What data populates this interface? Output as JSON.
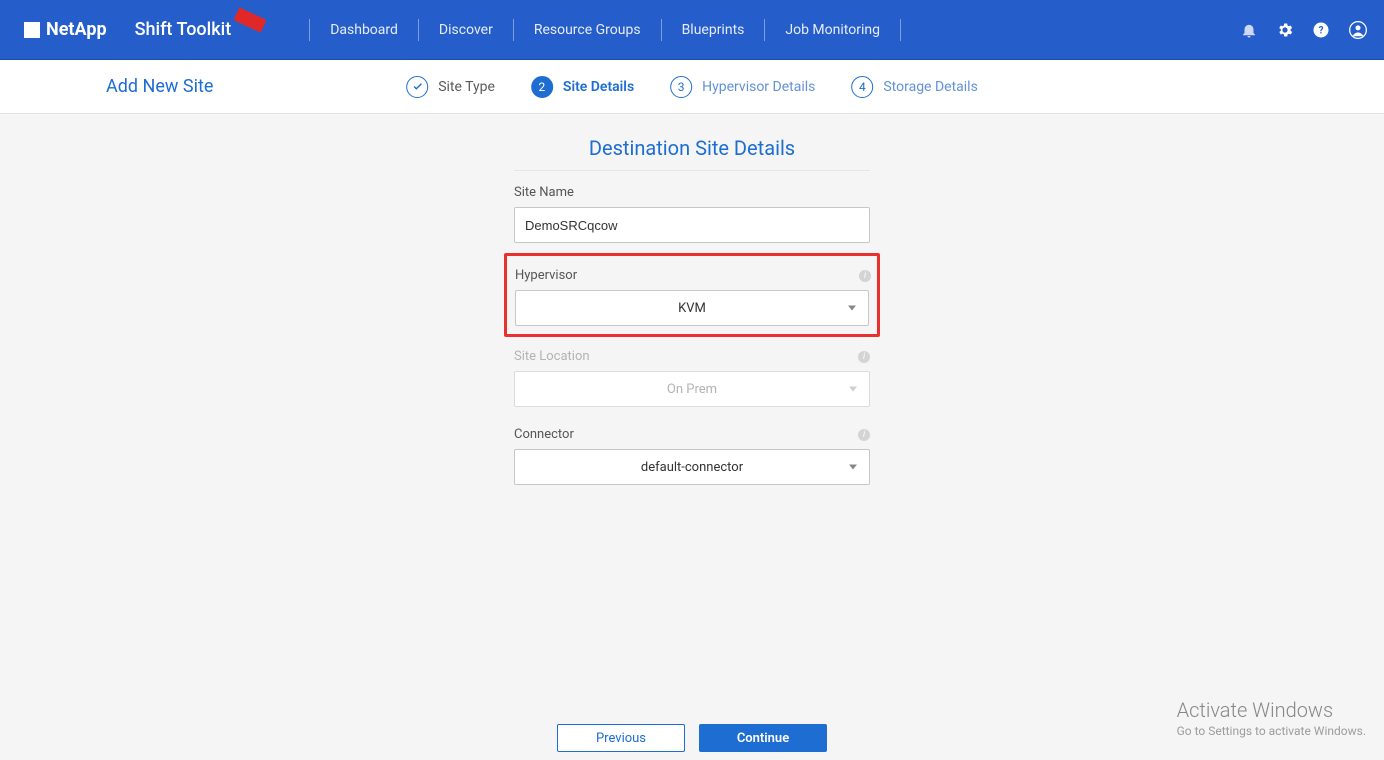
{
  "brand": {
    "company": "NetApp",
    "product": "Shift Toolkit"
  },
  "nav": {
    "items": [
      "Dashboard",
      "Discover",
      "Resource Groups",
      "Blueprints",
      "Job Monitoring"
    ]
  },
  "page": {
    "title": "Add New Site"
  },
  "stepper": {
    "steps": [
      {
        "label": "Site Type"
      },
      {
        "num": "2",
        "label": "Site Details"
      },
      {
        "num": "3",
        "label": "Hypervisor Details"
      },
      {
        "num": "4",
        "label": "Storage Details"
      }
    ]
  },
  "panel": {
    "title": "Destination Site Details",
    "site_name_label": "Site Name",
    "site_name_value": "DemoSRCqcow",
    "hypervisor_label": "Hypervisor",
    "hypervisor_value": "KVM",
    "site_location_label": "Site Location",
    "site_location_value": "On Prem",
    "connector_label": "Connector",
    "connector_value": "default-connector"
  },
  "buttons": {
    "previous": "Previous",
    "continue": "Continue"
  },
  "watermark": {
    "line1": "Activate Windows",
    "line2": "Go to Settings to activate Windows."
  }
}
